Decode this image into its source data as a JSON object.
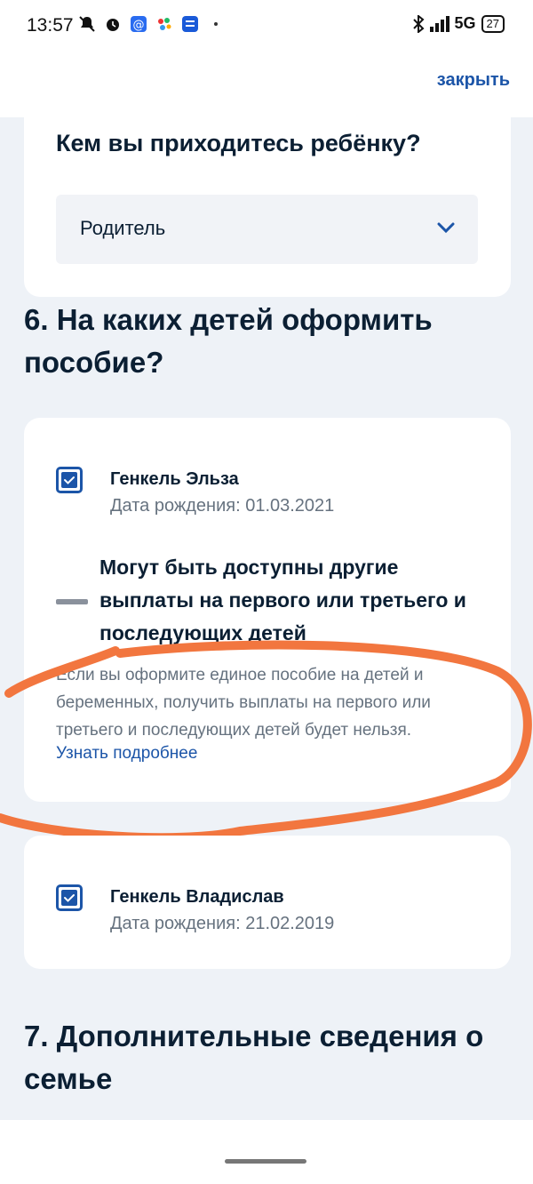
{
  "status_bar": {
    "time": "13:57",
    "network": "5G",
    "battery": "27"
  },
  "header": {
    "close_label": "закрыть"
  },
  "parent_card": {
    "question": "Кем вы приходитесь ребёнку?",
    "selected": "Родитель"
  },
  "section6": {
    "title_line1": "6. На каких детей оформить",
    "title_line2": "пособие?"
  },
  "children": [
    {
      "name": "Генкель Эльза",
      "dob": "Дата рождения: 01.03.2021",
      "checked": true
    },
    {
      "name": "Генкель Владислав",
      "dob": "Дата рождения: 21.02.2019",
      "checked": true
    }
  ],
  "warning": {
    "title_line1": "Могут быть доступны другие",
    "title_line2": "выплаты на первого или третьего и",
    "title_line3": "последующих детей",
    "text_line1": "Если вы оформите единое пособие на детей и",
    "text_line2": "беременных, получить выплаты на первого или",
    "text_line3": "третьего и последующих детей будет нельзя.",
    "link": "Узнать подробнее"
  },
  "section7": {
    "title_line1": "7. Дополнительные сведения о",
    "title_line2": "семье"
  },
  "colors": {
    "accent": "#1c55a8",
    "annotation": "#f2763f",
    "background": "#eef2f7"
  }
}
